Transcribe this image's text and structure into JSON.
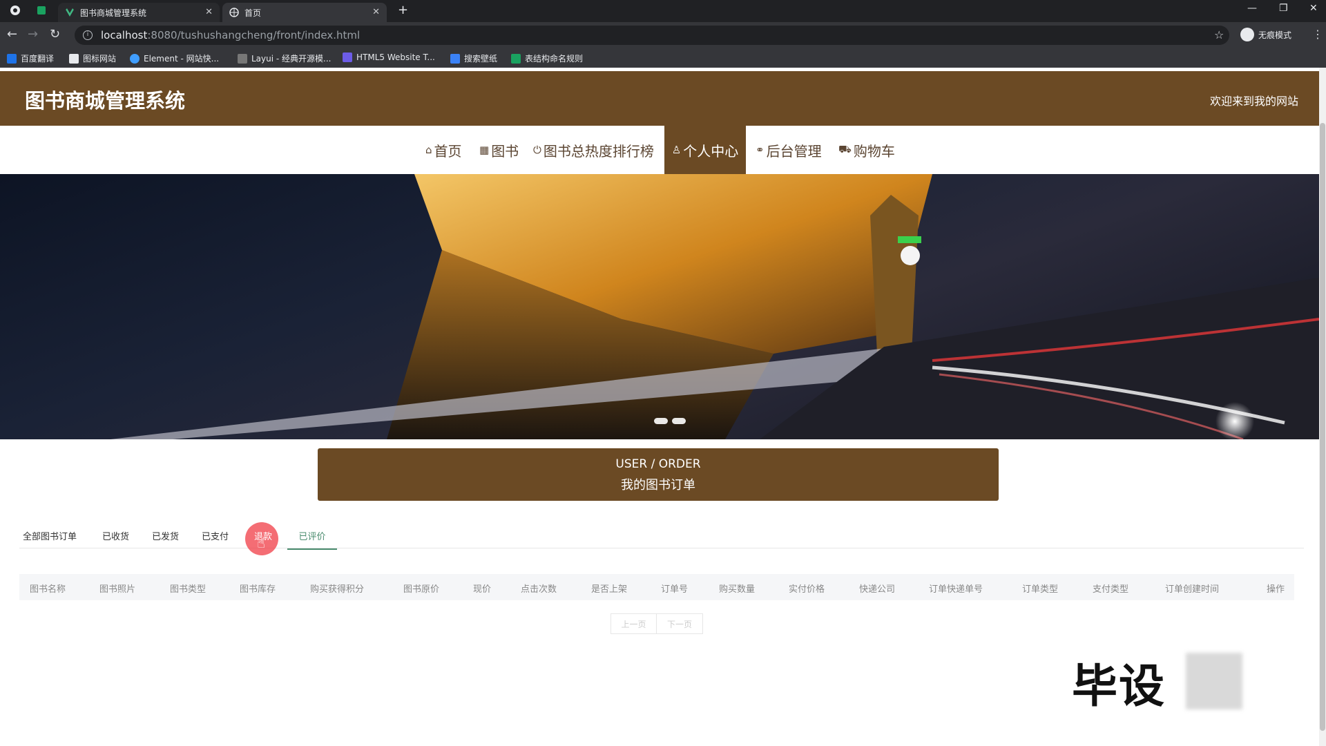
{
  "browser": {
    "tabs": [
      {
        "title": "图书商城管理系统",
        "active": false
      },
      {
        "title": "首页",
        "active": true
      }
    ],
    "url_host": "localhost",
    "url_path": ":8080/tushushangcheng/front/index.html",
    "profile_label": "无痕模式",
    "bookmarks": [
      "百度翻译",
      "图标网站",
      "Element - 网站快...",
      "Layui - 经典开源模...",
      "HTML5 Website T...",
      "搜索壁纸",
      "表结构命名规则"
    ]
  },
  "header": {
    "title": "图书商城管理系统",
    "welcome": "欢迎来到我的网站"
  },
  "nav": {
    "items": [
      {
        "label": "首页",
        "icon": "home-icon"
      },
      {
        "label": "图书",
        "icon": "grid-icon"
      },
      {
        "label": "图书总热度排行榜",
        "icon": "power-icon"
      },
      {
        "label": "个人中心",
        "icon": "user-icon",
        "active": true
      },
      {
        "label": "后台管理",
        "icon": "link-icon"
      },
      {
        "label": "购物车",
        "icon": "cart-icon"
      }
    ]
  },
  "section": {
    "title_en": "USER / ORDER",
    "title_cn": "我的图书订单"
  },
  "order_tabs": [
    "全部图书订单",
    "已收货",
    "已发货",
    "已支付",
    "退款",
    "已评价"
  ],
  "table": {
    "columns": [
      "图书名称",
      "图书照片",
      "图书类型",
      "图书库存",
      "购买获得积分",
      "图书原价",
      "现价",
      "点击次数",
      "是否上架",
      "订单号",
      "购买数量",
      "实付价格",
      "快递公司",
      "订单快递单号",
      "订单类型",
      "支付类型",
      "订单创建时间",
      "操作"
    ]
  },
  "pager": {
    "prev": "上一页",
    "next": "下一页"
  },
  "watermark": "毕设",
  "colors": {
    "brand": "#6b4a24",
    "active_tab": "#4a8c6e"
  }
}
